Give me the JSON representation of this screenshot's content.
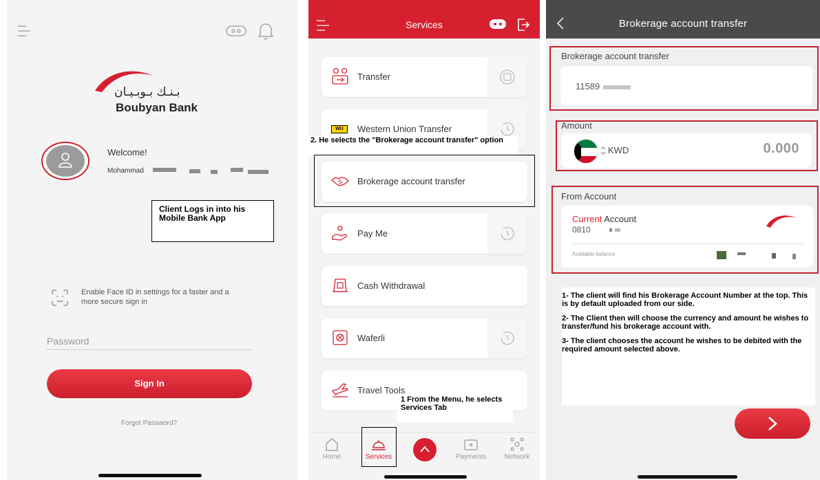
{
  "login": {
    "bank_name_arabic": "بـنـك بـوبـيـان",
    "bank_name": "Boubyan Bank",
    "welcome": "Welcome!",
    "username": "Mohammad",
    "callout": "Client Logs in into his Mobile Bank App",
    "face_id_text": "Enable Face ID in settings for a faster and a more secure sign in",
    "password_placeholder": "Password",
    "sign_in": "Sign In",
    "forgot_password": "Forgot Password?"
  },
  "services": {
    "title": "Services",
    "items": [
      {
        "label": "Transfer"
      },
      {
        "label": "Western Union Transfer",
        "badge": "WU"
      },
      {
        "label": "Brokerage account transfer"
      },
      {
        "label": "Pay Me"
      },
      {
        "label": "Cash Withdrawal"
      },
      {
        "label": "Waferli"
      },
      {
        "label": "Travel Tools"
      }
    ],
    "callout_step2": "2. He selects the \"Brokerage account transfer\" option",
    "callout_step1": "1  From the Menu, he selects Services Tab",
    "tabs": [
      {
        "label": "Home"
      },
      {
        "label": "Services"
      },
      {
        "label": "Payments"
      },
      {
        "label": "Network"
      }
    ]
  },
  "brokerage": {
    "title": "Brokerage account transfer",
    "section_account_label": "Brokerage account transfer",
    "account_number": "11589",
    "amount_label": "Amount",
    "currency": "KWD",
    "amount_value": "0.000",
    "from_account_label": "From Account",
    "account_type_highlight": "Current",
    "account_type_rest": " Account",
    "account_number_from": "0810",
    "available_balance_label": "Available balance",
    "instructions": [
      "1- The client will find his Brokerage Account Number at the top. This is by default uploaded from our side.",
      "2- The Client then will choose the currency and amount he wishes to transfer/fund his brokerage account with.",
      "3- The client chooses the account he wishes to be debited with the required amount selected above."
    ]
  },
  "colors": {
    "brand_red": "#d7202f",
    "header_dark": "#4a4a4a"
  }
}
